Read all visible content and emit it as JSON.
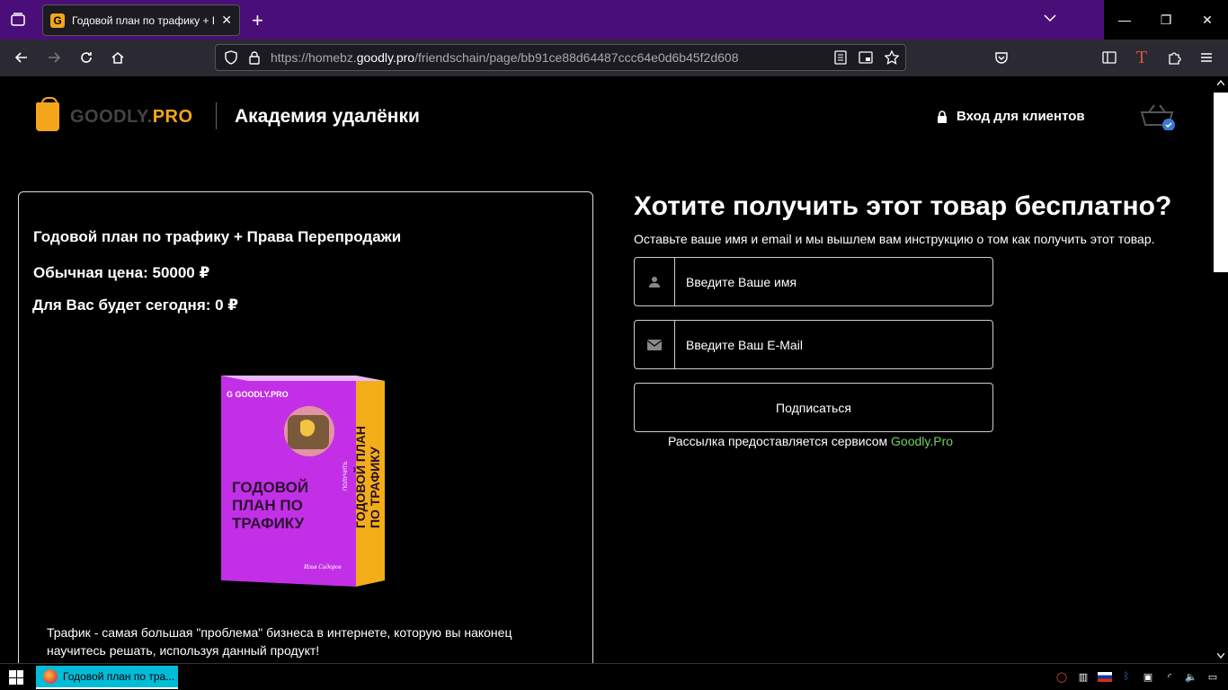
{
  "browser": {
    "tab_title": "Годовой план по трафику + П",
    "url_prefix": "https://homebz.",
    "url_domain": "goodly.pro",
    "url_path": "/friendschain/page/bb91ce88d64487ccc64e0d6b45f2d608"
  },
  "header": {
    "logo_brand_dark": "GOODLY.",
    "logo_brand_accent": "PRO",
    "academy_title": "Академия удалёнки",
    "login_label": "Вход для клиентов"
  },
  "product": {
    "title": "Годовой план по трафику + Права Перепродажи",
    "regular_price": "Обычная цена: 50000 ₽",
    "today_price": "Для Вас будет сегодня: 0 ₽",
    "box_brand": "GOODLY.PRO",
    "box_front_text": "ГОДОВОЙ ПЛАН ПО ТРАФИКУ",
    "box_side_text": "ГОДОВОЙ ПЛАН ПО ТРАФИКУ",
    "box_side_tag": "ПОЛУЧИТЬ",
    "description": "Трафик - самая большая \"проблема\" бизнеса в интернете, которую вы наконец научитесь решать, используя данный продукт!"
  },
  "form": {
    "heading": "Хотите получить этот товар бесплатно?",
    "subheading": "Оставьте ваше имя и email и мы вышлем вам инструкцию о том как получить этот товар.",
    "name_placeholder": "Введите Ваше имя",
    "email_placeholder": "Введите Ваш E-Mail",
    "subscribe_label": "Подписаться",
    "note_text": "Рассылка предоставляется сервисом ",
    "note_link": "Goodly.Pro"
  },
  "taskbar": {
    "task_label": "Годовой план по тра..."
  },
  "colors": {
    "accent": "#f4a51c",
    "link_green": "#6fcf5f",
    "tab_strip": "#4a0e78"
  }
}
